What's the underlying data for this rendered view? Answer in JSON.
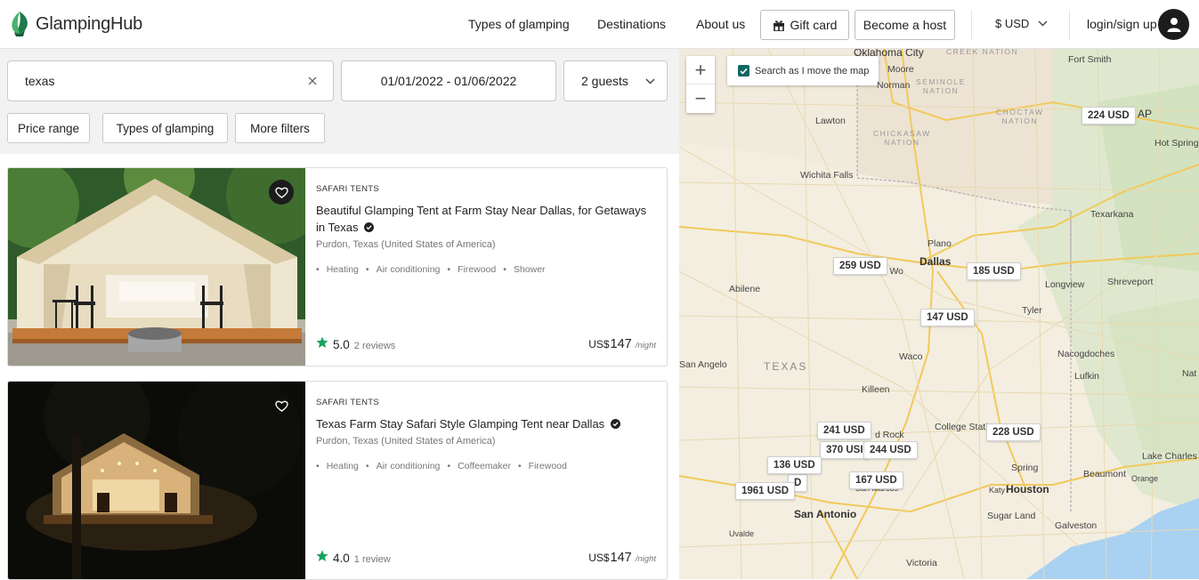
{
  "brand": {
    "name": "GlampingHub"
  },
  "header": {
    "nav": [
      "Types of glamping",
      "Destinations",
      "About us"
    ],
    "gift_card": "Gift card",
    "become_host": "Become a host",
    "currency": "$ USD",
    "login": "login/sign up"
  },
  "search": {
    "location_value": "texas",
    "dates_value": "01/01/2022 - 01/06/2022",
    "guests_value": "2 guests"
  },
  "filters": [
    "Price range",
    "Types of glamping",
    "More filters"
  ],
  "listings": [
    {
      "category": "SAFARI TENTS",
      "title": "Beautiful Glamping Tent at Farm Stay Near Dallas, for Getaways in Texas",
      "location": "Purdon, Texas (United States of America)",
      "amenities": [
        "Heating",
        "Air conditioning",
        "Firewood",
        "Shower"
      ],
      "rating": "5.0",
      "reviews": "2 reviews",
      "price_currency": "US$",
      "price": "147",
      "per": "/night"
    },
    {
      "category": "SAFARI TENTS",
      "title": "Texas Farm Stay Safari Style Glamping Tent near Dallas",
      "location": "Purdon, Texas (United States of America)",
      "amenities": [
        "Heating",
        "Air conditioning",
        "Coffeemaker",
        "Firewood"
      ],
      "rating": "4.0",
      "reviews": "1 review",
      "price_currency": "US$",
      "price": "147",
      "per": "/night"
    }
  ],
  "map": {
    "search_as_move": "Search as I move the map",
    "zoom_in": "+",
    "zoom_out": "−",
    "price_pins": [
      "224 USD",
      "259 USD",
      "185 USD",
      "147 USD",
      "241 USD",
      "370 USI",
      "244 USD",
      "228 USD",
      "136 USD",
      "167 USD",
      "1961 USD",
      "D"
    ],
    "cities": {
      "oklahoma_city": "Oklahoma City",
      "moore": "Moore",
      "norman": "Norman",
      "lawton": "Lawton",
      "wichita_falls": "Wichita Falls",
      "fort_smith": "Fort Smith",
      "hot_springs": "Hot Springs",
      "texarkana": "Texarkana",
      "plano": "Plano",
      "dallas": "Dallas",
      "abilene": "Abilene",
      "longview": "Longview",
      "shreveport": "Shreveport",
      "tyler": "Tyler",
      "waco": "Waco",
      "san_angelo": "San Angelo",
      "texas": "TEXAS",
      "nacogdoches": "Nacogdoches",
      "lufkin": "Lufkin",
      "killeen": "Killeen",
      "college_station": "College Statio",
      "round_rock": "d Rock",
      "san_marcos": "San Marcos",
      "spring": "Spring",
      "katy": "Katy",
      "houston": "Houston",
      "beaumont": "Beaumont",
      "orange": "Orange",
      "lake_charles": "Lake Charles",
      "sugar_land": "Sugar Land",
      "galveston": "Galveston",
      "san_antonio": "San Antonio",
      "uvalde": "Uvalde",
      "victoria": "Victoria",
      "nat": "Nat",
      "ap": "AP",
      "fort_worth": "rt Wo",
      "seminole": "SEMINOLE\nNATION",
      "chickasaw": "CHICKASAW\nNATION",
      "choctaw": "CHOCTAW\nNATION",
      "creek": "CREEK NATION"
    }
  },
  "colors": {
    "brand_green": "#2e9a5a",
    "star_green": "#1aa260",
    "checkbox_teal": "#116763"
  }
}
